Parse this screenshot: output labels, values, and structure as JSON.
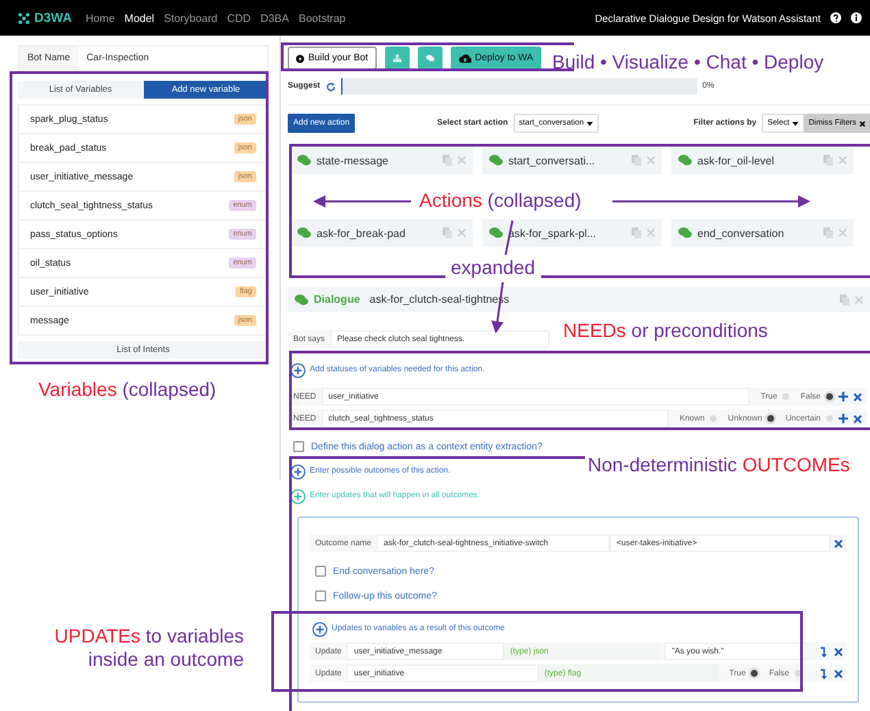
{
  "navbar": {
    "logo": "D3WA",
    "links": [
      {
        "label": "Home",
        "selected": false
      },
      {
        "label": "Model",
        "selected": true
      },
      {
        "label": "Storyboard",
        "selected": false
      },
      {
        "label": "CDD",
        "selected": false
      },
      {
        "label": "D3BA",
        "selected": false
      },
      {
        "label": "Bootstrap",
        "selected": false
      }
    ],
    "title": "Declarative Dialogue Design for Watson Assistant"
  },
  "sidebar": {
    "bot_name_label": "Bot Name",
    "bot_name": "Car-Inspection",
    "tabs": [
      {
        "label": "List of Variables",
        "selected": false
      },
      {
        "label": "Add new variable",
        "selected": true
      }
    ],
    "variables": [
      {
        "name": "spark_plug_status",
        "type": "json",
        "color": "#fbd3a0"
      },
      {
        "name": "break_pad_status",
        "type": "json",
        "color": "#fbd3a0"
      },
      {
        "name": "user_initiative_message",
        "type": "json",
        "color": "#fbd3a0"
      },
      {
        "name": "clutch_seal_tightness_status",
        "type": "enum",
        "color": "#e8d0f0"
      },
      {
        "name": "pass_status_options",
        "type": "enum",
        "color": "#e8d0f0"
      },
      {
        "name": "oil_status",
        "type": "enum",
        "color": "#e8d0f0"
      },
      {
        "name": "user_initiative",
        "type": "flag",
        "color": "#fbd3a0"
      },
      {
        "name": "message",
        "type": "json",
        "color": "#fbd3a0"
      }
    ],
    "intents_tab": "List of Intents"
  },
  "toolbar": {
    "build": "Build your Bot",
    "deploy": "Deploy to WA"
  },
  "suggest": {
    "label": "Suggest",
    "level": 0,
    "reading": "0%"
  },
  "actions_bar": {
    "add": "Add new action",
    "start_label": "Select start action",
    "start_value": "start_conversation",
    "filter_label": "Filter actions by",
    "filter_value": "Select",
    "dismiss": "Dimiss Filters"
  },
  "actions": [
    "state-message",
    "start_conversati...",
    "ask-for_oil-level",
    "ask-for_break-pad",
    "ask-for_spark-pl...",
    "end_conversation"
  ],
  "dialogue": {
    "kind_label": "Dialogue",
    "name": "ask-for_clutch-seal-tightness",
    "bot_says_label": "Bot says",
    "bot_says": "Please check clutch seal tightness.",
    "add_needs": "Add statuses of variables needed for this action.",
    "needs": [
      {
        "label": "NEED",
        "variable": "user_initiative",
        "options": [
          {
            "label": "True",
            "selected": false
          },
          {
            "label": "False",
            "selected": true
          }
        ]
      },
      {
        "label": "NEED",
        "variable": "clutch_seal_tightness_status",
        "options": [
          {
            "label": "Known",
            "selected": false
          },
          {
            "label": "Unknown",
            "selected": true
          },
          {
            "label": "Uncertain",
            "selected": false
          }
        ]
      }
    ],
    "context_extraction": {
      "label": "Define this dialog action as a context entity extraction?",
      "checked": false
    },
    "add_outcomes": "Enter possible outcomes of this action.",
    "add_updates_all": "Enter updates that will happen in all outcomes.",
    "outcome": {
      "name_label": "Outcome name",
      "name": "ask-for_clutch-seal-tightness_initiative-switch",
      "tag": "<user-takes-initiative>",
      "end_conversation": {
        "label": "End conversation here?",
        "checked": false
      },
      "follow_up": {
        "label": "Follow-up this outcome?",
        "checked": false
      },
      "add_updates": "Updates to variables as a result of this outcome",
      "updates": [
        {
          "kind": "value",
          "label": "Update",
          "variable": "user_initiative_message",
          "type": "(type) json",
          "value": "\"As you wish.\""
        },
        {
          "kind": "choice",
          "label": "Update",
          "variable": "user_initiative",
          "type": "(type) flag",
          "options": [
            {
              "label": "True",
              "selected": true
            },
            {
              "label": "False",
              "selected": false
            }
          ]
        }
      ]
    }
  },
  "annotations": [
    {
      "parts": [
        {
          "text": "Build • Visualize • Chat • Deploy",
          "emphasis": false
        }
      ]
    },
    {
      "parts": [
        {
          "text": "Actions",
          "emphasis": true
        },
        {
          "text": " (collapsed)",
          "emphasis": false
        }
      ]
    },
    {
      "parts": [
        {
          "text": "expanded",
          "emphasis": false
        }
      ]
    },
    {
      "parts": [
        {
          "text": "NEEDs",
          "emphasis": true
        },
        {
          "text": " or preconditions",
          "emphasis": false
        }
      ]
    },
    {
      "parts": [
        {
          "text": "Non-deterministic ",
          "emphasis": false
        },
        {
          "text": "OUTCOMEs",
          "emphasis": true
        }
      ]
    },
    {
      "parts": [
        {
          "text": "Variables",
          "emphasis": true
        },
        {
          "text": " (collapsed)",
          "emphasis": false
        }
      ]
    },
    {
      "parts": [
        {
          "text": "UPDATEs",
          "emphasis": true
        },
        {
          "text": " to variables",
          "emphasis": false
        },
        {
          "text": "inside an outcome",
          "emphasis": false,
          "line_break": true
        }
      ]
    }
  ]
}
